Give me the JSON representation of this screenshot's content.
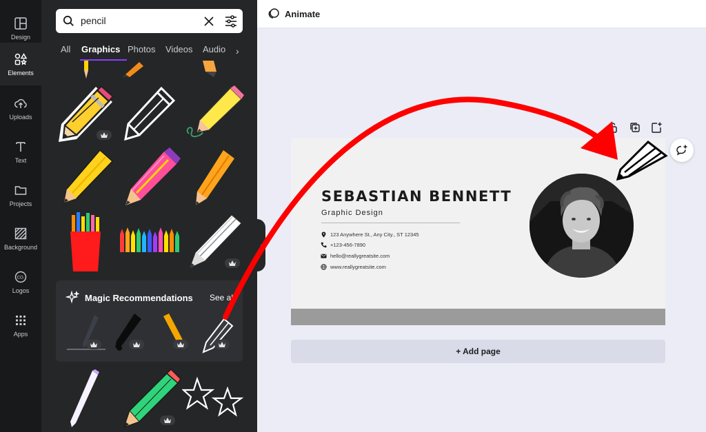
{
  "rail": {
    "items": [
      {
        "label": "Design",
        "icon": "layout-icon"
      },
      {
        "label": "Elements",
        "icon": "shapes-icon"
      },
      {
        "label": "Uploads",
        "icon": "cloud-upload-icon"
      },
      {
        "label": "Text",
        "icon": "text-icon"
      },
      {
        "label": "Projects",
        "icon": "folder-icon"
      },
      {
        "label": "Background",
        "icon": "background-pattern-icon"
      },
      {
        "label": "Logos",
        "icon": "logo-icon"
      },
      {
        "label": "Apps",
        "icon": "apps-grid-icon"
      }
    ],
    "active": "Elements"
  },
  "search": {
    "value": "pencil"
  },
  "tabs": [
    {
      "label": "All"
    },
    {
      "label": "Graphics",
      "active": true
    },
    {
      "label": "Photos"
    },
    {
      "label": "Videos"
    },
    {
      "label": "Audio"
    }
  ],
  "magic": {
    "title": "Magic Recommendations",
    "see_all": "See all"
  },
  "topbar": {
    "animate_label": "Animate"
  },
  "card": {
    "name": "SEBASTIAN BENNETT",
    "role": "Graphic Design",
    "contacts": [
      {
        "icon": "location-pin-icon",
        "text": "123 Anywhere St., Any City., ST 12345"
      },
      {
        "icon": "phone-icon",
        "text": "+123-456-7890"
      },
      {
        "icon": "mail-icon",
        "text": "hello@reallygreatsite.com"
      },
      {
        "icon": "globe-icon",
        "text": "www.reallygreatsite.com"
      }
    ]
  },
  "add_page_label": "+ Add page",
  "colors": {
    "rail_bg": "#18191b",
    "panel_bg": "#252627",
    "accent": "#8b3dff",
    "canvas_bg": "#ebecf5",
    "annotation_arrow": "#ff0000"
  }
}
